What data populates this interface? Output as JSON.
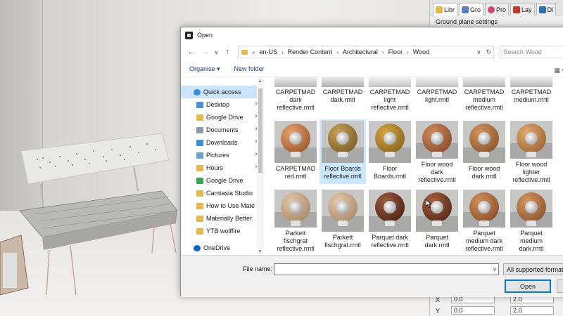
{
  "side_panel": {
    "tabs": [
      {
        "label": "Libr",
        "icon": "folder-icon",
        "color": "#e8b84a"
      },
      {
        "label": "Gro",
        "icon": "layer-group-icon",
        "color": "#5a7fbf"
      },
      {
        "label": "Pro",
        "icon": "properties-icon",
        "color": "#c9477b"
      },
      {
        "label": "Lay",
        "icon": "layers-icon",
        "color": "#c0392b"
      },
      {
        "label": "Di",
        "icon": "display-icon",
        "color": "#2f6fb5"
      }
    ],
    "title": "Ground plane settings",
    "bottom_fields": {
      "x_label": "X",
      "x_value": "0.0",
      "y_label": "Y",
      "y_value": "0.0",
      "w1_value": "2.0",
      "w2_value": "2.0"
    }
  },
  "dialog": {
    "title": "Open",
    "nav": {
      "back": "←",
      "forward": "→",
      "up": "↑",
      "dropdown": "∨"
    },
    "address": {
      "overflow": "«",
      "crumbs": [
        "en-US",
        "Render Content",
        "Architectural",
        "Floor",
        "Wood"
      ],
      "refresh": "↻"
    },
    "search": {
      "placeholder": "Search Wood"
    },
    "commands": {
      "organise": "Organise ▾",
      "new_folder": "New folder"
    },
    "nav_pane": [
      {
        "label": "Quick access",
        "icon": "star-icon",
        "color": "#3a8ee6",
        "pinned": false
      },
      {
        "label": "Desktop",
        "icon": "desktop-icon",
        "color": "#4a90d9",
        "pinned": true
      },
      {
        "label": "Google Drive",
        "icon": "folder-icon",
        "color": "#e8b84a",
        "pinned": true
      },
      {
        "label": "Documents",
        "icon": "documents-icon",
        "color": "#8a9bb0",
        "pinned": true
      },
      {
        "label": "Downloads",
        "icon": "download-icon",
        "color": "#3a8ee6",
        "pinned": true
      },
      {
        "label": "Pictures",
        "icon": "pictures-icon",
        "color": "#6aa0d0",
        "pinned": true
      },
      {
        "label": "Hours",
        "icon": "folder-icon",
        "color": "#e8b84a",
        "pinned": true
      },
      {
        "label": "Google Drive",
        "icon": "google-drive-icon",
        "color": "#34a853",
        "pinned": false
      },
      {
        "label": "Camtasia Studio",
        "icon": "folder-icon",
        "color": "#e8b84a",
        "pinned": false
      },
      {
        "label": "How to Use Mate",
        "icon": "folder-icon",
        "color": "#e8b84a",
        "pinned": false
      },
      {
        "label": "Materially Better",
        "icon": "folder-icon",
        "color": "#e8b84a",
        "pinned": false
      },
      {
        "label": "YTB wolffire",
        "icon": "folder-icon",
        "color": "#e8b84a",
        "pinned": false
      },
      {
        "label": "OneDrive",
        "icon": "onedrive-icon",
        "color": "#0a64c8",
        "pinned": false
      }
    ],
    "files_row0": [
      {
        "name": "CARPETMAD dark reflective.rmtl",
        "c1": "#eeeeee",
        "c2": "#b8b8b8"
      },
      {
        "name": "CARPETMAD dark.rmtl",
        "c1": "#e9e9e9",
        "c2": "#b0b0b0"
      },
      {
        "name": "CARPETMAD light reflective.rmtl",
        "c1": "#f1f1f1",
        "c2": "#c2c2c2"
      },
      {
        "name": "CARPETMAD light.rmtl",
        "c1": "#f1f1f1",
        "c2": "#c2c2c2"
      },
      {
        "name": "CARPETMAD medium reflective.rmtl",
        "c1": "#ececec",
        "c2": "#b7b7b7"
      },
      {
        "name": "CARPETMAD medium.rmtl",
        "c1": "#ececec",
        "c2": "#b7b7b7"
      }
    ],
    "files_row1": [
      {
        "name": "CARPETMAD red.rmtl",
        "c1": "#e6a06a",
        "c2": "#8c4a22"
      },
      {
        "name": "Floor Boards reflective.rmtl",
        "c1": "#c7a056",
        "c2": "#6b5020"
      },
      {
        "name": "Floor Boards.rmtl",
        "c1": "#d4a43e",
        "c2": "#7a5a1a"
      },
      {
        "name": "Floor wood dark reflective.rmtl",
        "c1": "#d0895a",
        "c2": "#7a4222"
      },
      {
        "name": "Floor wood dark.rmtl",
        "c1": "#d3935c",
        "c2": "#7c4a24"
      },
      {
        "name": "Floor wood lighter reflective.rmtl",
        "c1": "#e3a76a",
        "c2": "#8e5a2c"
      }
    ],
    "files_row2": [
      {
        "name": "Parkett fischgrat reflective.rmtl",
        "c1": "#e2c7a8",
        "c2": "#9a7c5c"
      },
      {
        "name": "Parkett fischgrat.rmtl",
        "c1": "#e4c9aa",
        "c2": "#9c7e5e"
      },
      {
        "name": "Parquet  dark reflective.rmtl",
        "c1": "#9a5a3c",
        "c2": "#3e1a0e"
      },
      {
        "name": "Parquet dark.rmtl",
        "c1": "#a4603e",
        "c2": "#44200f"
      },
      {
        "name": "Parquet medium dark reflective.rmtl",
        "c1": "#d28e58",
        "c2": "#7a4522"
      },
      {
        "name": "Parquet medium dark.rmtl",
        "c1": "#d49460",
        "c2": "#7c4a26"
      }
    ],
    "footer": {
      "file_name_label": "File name:",
      "file_name_value": "",
      "file_type": "All supported formats",
      "open_label": "Open"
    }
  }
}
